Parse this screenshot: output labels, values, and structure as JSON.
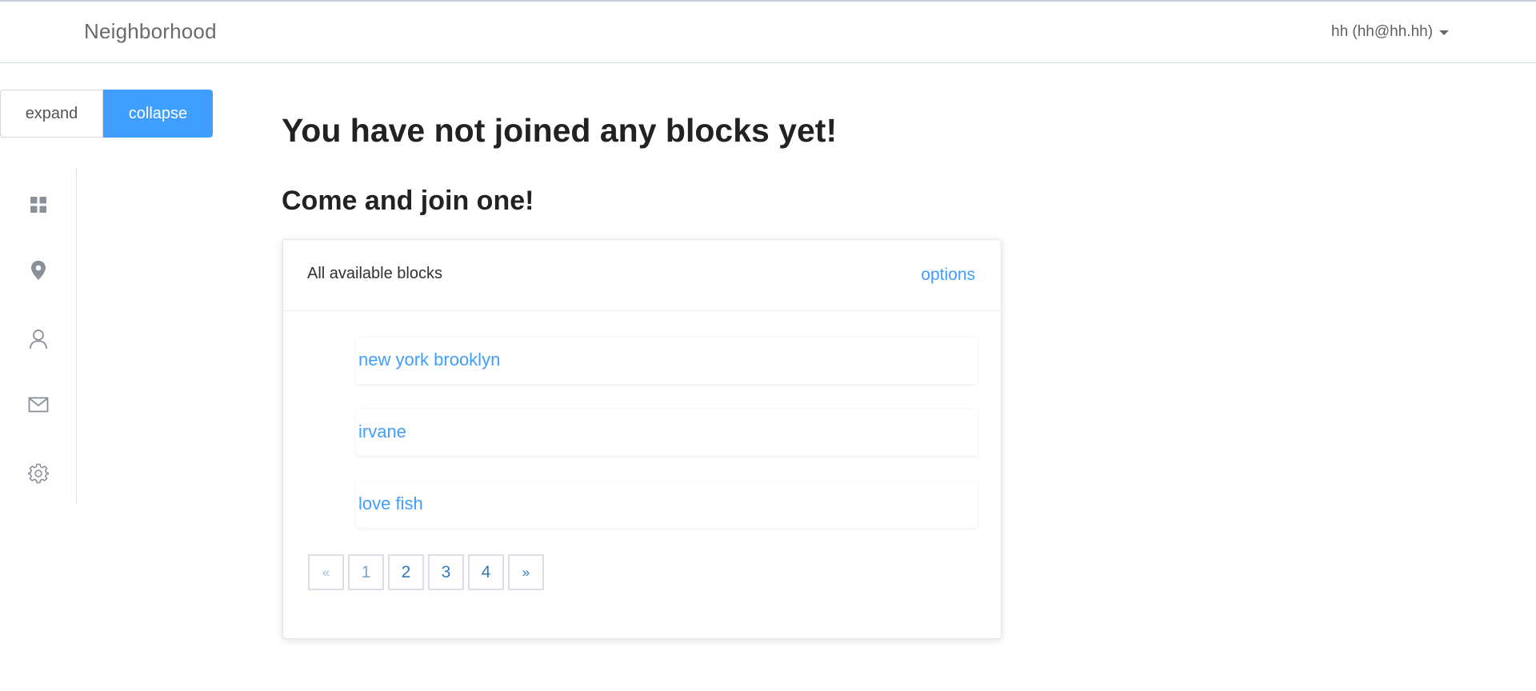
{
  "header": {
    "brand": "Neighborhood",
    "user_label": "hh (hh@hh.hh)"
  },
  "sidebar": {
    "expand_label": "expand",
    "collapse_label": "collapse",
    "items": [
      {
        "icon": "dashboard-icon"
      },
      {
        "icon": "location-pin-icon"
      },
      {
        "icon": "user-icon"
      },
      {
        "icon": "mail-icon"
      },
      {
        "icon": "gear-icon"
      }
    ]
  },
  "main": {
    "title": "You have not joined any blocks yet!",
    "subtitle": "Come and join one!",
    "card": {
      "title": "All available blocks",
      "options_label": "options",
      "blocks": [
        "new york brooklyn",
        "irvane",
        "love fish"
      ],
      "pagination": {
        "prev": "«",
        "pages": [
          "1",
          "2",
          "3",
          "4"
        ],
        "current": "1",
        "next": "»"
      }
    }
  },
  "colors": {
    "accent": "#409eff",
    "link": "#409eff",
    "pager_text": "#337ab7"
  }
}
